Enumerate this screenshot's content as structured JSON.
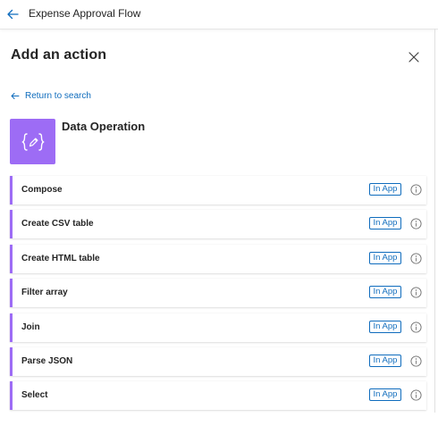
{
  "header": {
    "flow_title": "Expense Approval Flow",
    "back_icon": "arrow-left-icon"
  },
  "panel": {
    "title": "Add an action",
    "close_icon": "close-icon",
    "return_label": "Return to search",
    "return_icon": "arrow-left-icon"
  },
  "connector": {
    "name": "Data Operation",
    "icon": "data-operation-icon",
    "color": "#9d6cf5"
  },
  "actions": [
    {
      "label": "Compose",
      "badge": "In App"
    },
    {
      "label": "Create CSV table",
      "badge": "In App"
    },
    {
      "label": "Create HTML table",
      "badge": "In App"
    },
    {
      "label": "Filter array",
      "badge": "In App"
    },
    {
      "label": "Join",
      "badge": "In App"
    },
    {
      "label": "Parse JSON",
      "badge": "In App"
    },
    {
      "label": "Select",
      "badge": "In App"
    }
  ],
  "colors": {
    "accent": "#0f6cbd",
    "connector": "#9d6cf5"
  }
}
